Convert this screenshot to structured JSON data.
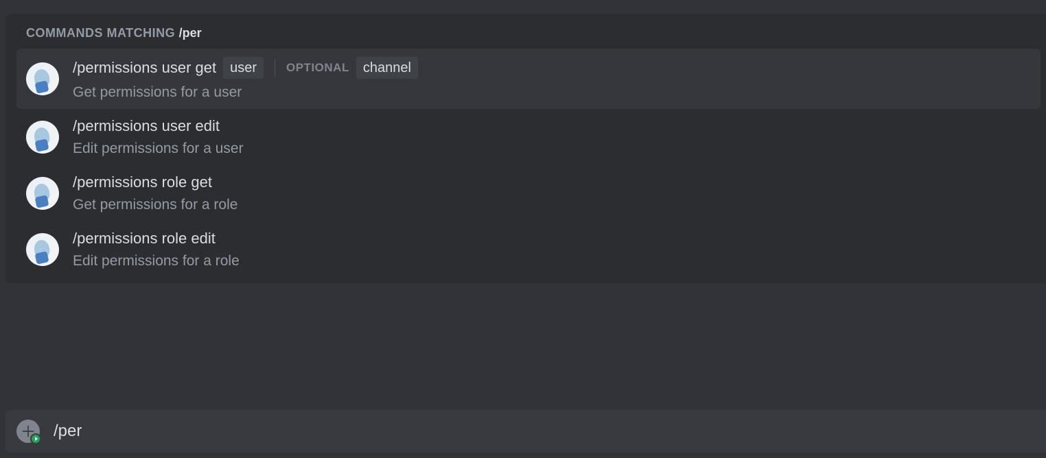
{
  "autocomplete": {
    "header_prefix": "COMMANDS MATCHING ",
    "header_query": "/per",
    "optional_label": "OPTIONAL",
    "commands": [
      {
        "name": "/permissions user get",
        "description": "Get permissions for a user",
        "required_params": [
          "user"
        ],
        "optional_params": [
          "channel"
        ],
        "selected": true
      },
      {
        "name": "/permissions user edit",
        "description": "Edit permissions for a user",
        "required_params": [],
        "optional_params": [],
        "selected": false
      },
      {
        "name": "/permissions role get",
        "description": "Get permissions for a role",
        "required_params": [],
        "optional_params": [],
        "selected": false
      },
      {
        "name": "/permissions role edit",
        "description": "Edit permissions for a role",
        "required_params": [],
        "optional_params": [],
        "selected": false
      }
    ]
  },
  "input": {
    "value": "/per"
  }
}
